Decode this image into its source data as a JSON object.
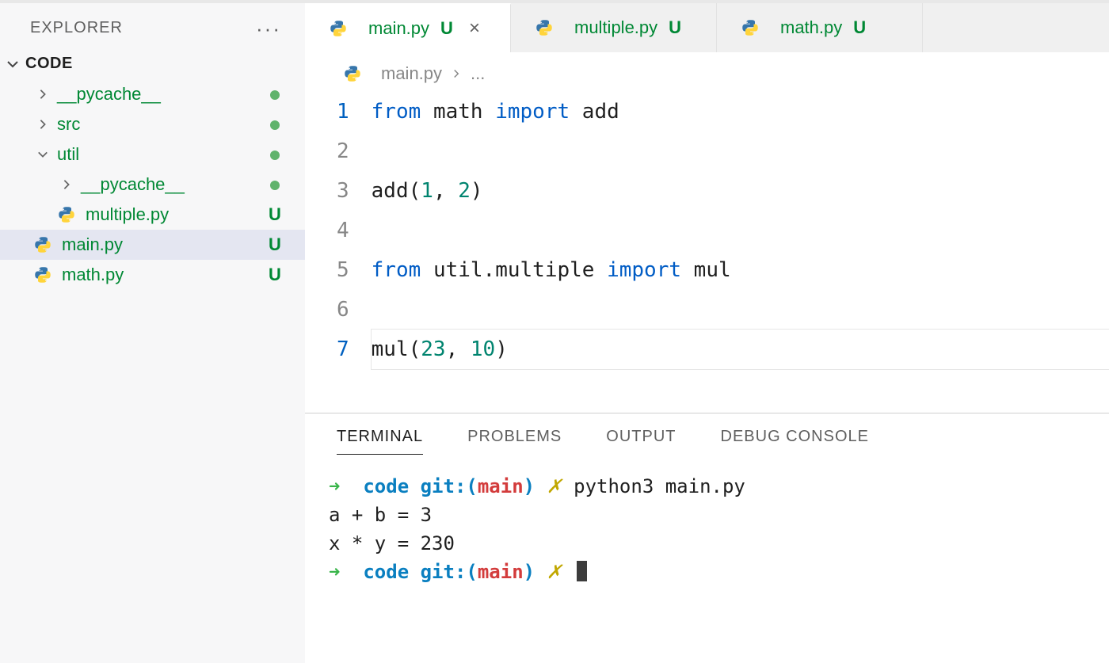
{
  "sidebar": {
    "explorer_label": "EXPLORER",
    "section_title": "CODE",
    "tree": [
      {
        "kind": "folder",
        "name": "__pycache__",
        "expanded": false,
        "status": "dot",
        "depth": 1
      },
      {
        "kind": "folder",
        "name": "src",
        "expanded": false,
        "status": "dot",
        "depth": 1
      },
      {
        "kind": "folder",
        "name": "util",
        "expanded": true,
        "status": "dot",
        "depth": 1
      },
      {
        "kind": "folder",
        "name": "__pycache__",
        "expanded": false,
        "status": "dot",
        "depth": 2
      },
      {
        "kind": "file",
        "name": "multiple.py",
        "status": "U",
        "depth": 2
      },
      {
        "kind": "file",
        "name": "main.py",
        "status": "U",
        "depth": 1,
        "active": true
      },
      {
        "kind": "file",
        "name": "math.py",
        "status": "U",
        "depth": 1
      }
    ]
  },
  "tabs": [
    {
      "name": "main.py",
      "status": "U",
      "active": true,
      "closable": true
    },
    {
      "name": "multiple.py",
      "status": "U",
      "active": false,
      "closable": false
    },
    {
      "name": "math.py",
      "status": "U",
      "active": false,
      "closable": false
    }
  ],
  "breadcrumb": {
    "file": "main.py",
    "tail": "..."
  },
  "editor": {
    "current_line": 7,
    "lines": [
      {
        "n": 1,
        "tokens": [
          {
            "t": "from ",
            "c": "kw"
          },
          {
            "t": "math "
          },
          {
            "t": "import ",
            "c": "kw"
          },
          {
            "t": "add"
          }
        ]
      },
      {
        "n": 2,
        "tokens": []
      },
      {
        "n": 3,
        "tokens": [
          {
            "t": "add("
          },
          {
            "t": "1",
            "c": "num"
          },
          {
            "t": ", "
          },
          {
            "t": "2",
            "c": "num"
          },
          {
            "t": ")"
          }
        ]
      },
      {
        "n": 4,
        "tokens": []
      },
      {
        "n": 5,
        "tokens": [
          {
            "t": "from ",
            "c": "kw"
          },
          {
            "t": "util.multiple "
          },
          {
            "t": "import ",
            "c": "kw"
          },
          {
            "t": "mul"
          }
        ]
      },
      {
        "n": 6,
        "tokens": []
      },
      {
        "n": 7,
        "tokens": [
          {
            "t": "mul("
          },
          {
            "t": "23",
            "c": "num"
          },
          {
            "t": ", "
          },
          {
            "t": "10",
            "c": "num"
          },
          {
            "t": ")"
          }
        ]
      }
    ]
  },
  "panel": {
    "tabs": [
      {
        "label": "TERMINAL",
        "active": true
      },
      {
        "label": "PROBLEMS"
      },
      {
        "label": "OUTPUT"
      },
      {
        "label": "DEBUG CONSOLE"
      }
    ],
    "prompt_arrow": "➜",
    "prompt_cwd": "code",
    "prompt_git_prefix": "git:(",
    "prompt_branch": "main",
    "prompt_git_suffix": ")",
    "prompt_dirty": "✗",
    "command1": "python3 main.py",
    "output": [
      "a + b = 3",
      "x * y = 230"
    ]
  }
}
